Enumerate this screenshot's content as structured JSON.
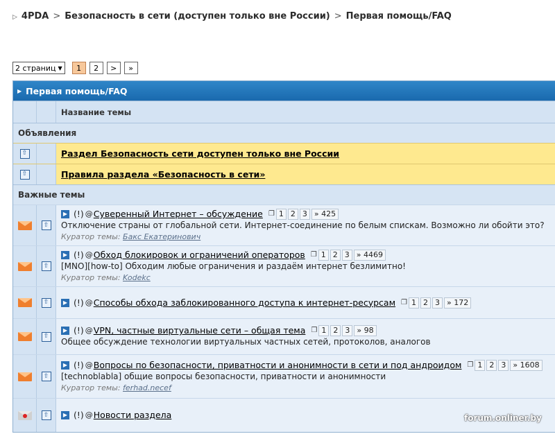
{
  "breadcrumb": {
    "root": "4PDA",
    "forum": "Безопасность в сети (доступен только вне России)",
    "current": "Первая помощь/FAQ",
    "separator": ">"
  },
  "pager": {
    "pages_select": "2 страниц",
    "current": "1",
    "page2": "2",
    "next": ">",
    "last": "»"
  },
  "forum": {
    "title": "Первая помощь/FAQ",
    "column_title": "Название темы",
    "announcements_label": "Объявления",
    "announcements": [
      {
        "title": "Раздел Безопасность сети доступен только вне России"
      },
      {
        "title": "Правила раздела «Безопасность в сети»"
      }
    ],
    "important_label": "Важные темы",
    "topics": [
      {
        "prefix": "(!)",
        "title": "Суверенный Интернет – обсуждение",
        "pages": [
          "1",
          "2",
          "3"
        ],
        "last": "» 425",
        "description": "Отключение страны от глобальной сети. Интернет-соединение по белым спискам. Возможно ли обойти это?",
        "curator_label": "Куратор темы:",
        "curator": "Бакс Екатеринович"
      },
      {
        "prefix": "(!)",
        "title": "Обход блокировок и ограничений операторов",
        "pages": [
          "1",
          "2",
          "3"
        ],
        "last": "» 4469",
        "description": "[MNO][how-to] Обходим любые ограничения и раздаём интернет безлимитно!",
        "curator_label": "Куратор темы:",
        "curator": "Kodekc"
      },
      {
        "prefix": "(!)",
        "title": "Способы обхода заблокированного доступа к интернет-ресурсам",
        "pages": [
          "1",
          "2",
          "3"
        ],
        "last": "» 172"
      },
      {
        "prefix": "(!)",
        "title": "VPN, частные виртуальные сети – общая тема",
        "pages": [
          "1",
          "2",
          "3"
        ],
        "last": "» 98",
        "description": "Общее обсуждение технологии виртуальных частных сетей, протоколов, аналогов"
      },
      {
        "prefix": "(!)",
        "title": "Вопросы по безопасности, приватности и анонимности в сети и под андроидом",
        "pages": [
          "1",
          "2",
          "3"
        ],
        "last": "» 1608",
        "description": "[technoblabla] общие вопросы безопасности, приватности и анонимности",
        "curator_label": "Куратор темы:",
        "curator": "ferhad.necef"
      },
      {
        "prefix": "(!)",
        "title": "Новости раздела"
      }
    ]
  },
  "watermark": "forum.onliner.by"
}
